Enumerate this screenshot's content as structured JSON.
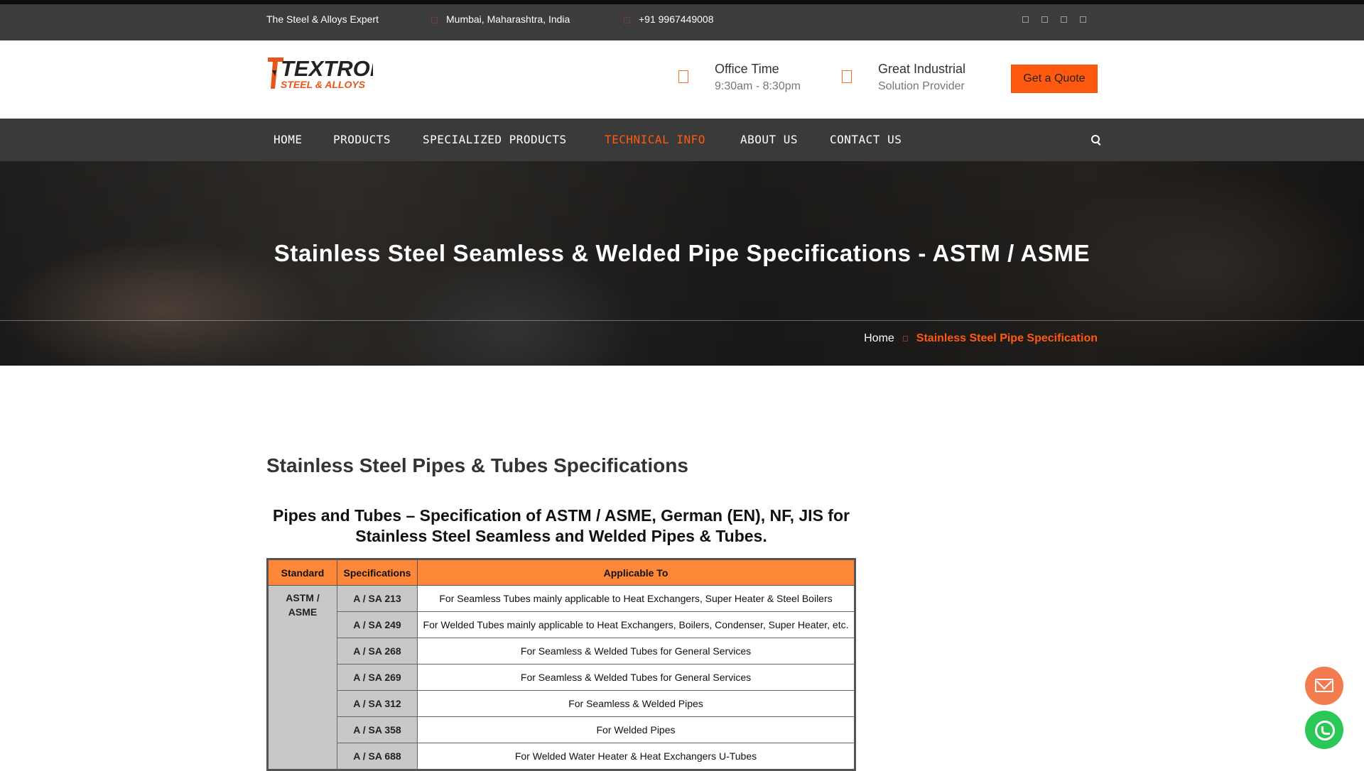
{
  "topbar": {
    "tagline": "The Steel & Alloys Expert",
    "location": "Mumbai, Maharashtra, India",
    "phone": "+91 9967449008",
    "social_icons": [
      "facebook-icon",
      "twitter-icon",
      "linkedin-icon",
      "instagram-icon"
    ]
  },
  "header": {
    "logo_text": "TEXTRON",
    "logo_subtext": "STEEL & ALLOYS",
    "office_title": "Office Time",
    "office_hours": "9:30am - 8:30pm",
    "industrial_title": "Great Industrial",
    "industrial_sub": "Solution Provider",
    "quote_label": "Get a Quote"
  },
  "nav": {
    "items": [
      "HOME",
      "PRODUCTS",
      "SPECIALIZED PRODUCTS",
      "TECHNICAL INFO",
      "ABOUT US",
      "CONTACT US"
    ],
    "active": "TECHNICAL INFO"
  },
  "hero": {
    "title": "Stainless Steel Seamless & Welded Pipe Specifications - ASTM / ASME",
    "breadcrumb_home": "Home",
    "breadcrumb_current": "Stainless Steel Pipe Specification"
  },
  "content": {
    "section_title": "Stainless Steel Pipes & Tubes Specifications",
    "table_heading_line1": "Pipes and Tubes – Specification of ASTM / ASME, German (EN), NF, JIS for",
    "table_heading_line2": "Stainless Steel Seamless and Welded Pipes & Tubes.",
    "table": {
      "headers": [
        "Standard",
        "Specifications",
        "Applicable To"
      ],
      "standard_line1": "ASTM /",
      "standard_line2": "ASME",
      "rows": [
        {
          "spec": "A / SA 213",
          "desc": "For Seamless Tubes mainly applicable to Heat Exchangers, Super Heater & Steel Boilers"
        },
        {
          "spec": "A / SA 249",
          "desc": "For Welded Tubes mainly applicable to Heat Exchangers, Boilers, Condenser, Super Heater, etc."
        },
        {
          "spec": "A / SA 268",
          "desc": "For Seamless & Welded Tubes for General Services"
        },
        {
          "spec": "A / SA 269",
          "desc": "For Seamless & Welded Tubes for General Services"
        },
        {
          "spec": "A / SA 312",
          "desc": "For Seamless & Welded Pipes"
        },
        {
          "spec": "A / SA 358",
          "desc": "For Welded Pipes"
        },
        {
          "spec": "A / SA 688",
          "desc": "For Welded Water Heater & Heat Exchangers U-Tubes"
        }
      ]
    }
  },
  "colors": {
    "accent": "#ff5a0f",
    "table_header": "#ff8838",
    "email_button": "#f47b50",
    "whatsapp_button": "#2bc857"
  }
}
